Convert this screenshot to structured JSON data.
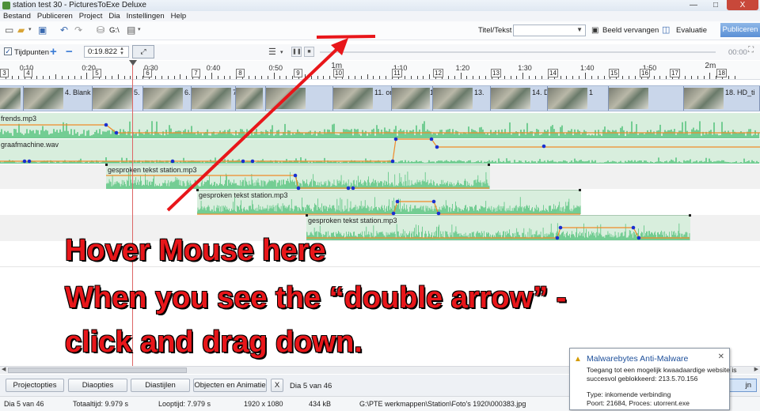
{
  "window": {
    "title": "station test 30 - PicturesToExe Deluxe",
    "minimize": "—",
    "maximize": "□",
    "close": "X"
  },
  "menu": [
    "Bestand",
    "Publiceren",
    "Project",
    "Dia",
    "Instellingen",
    "Help"
  ],
  "toolbar": {
    "path_label": "G:\\",
    "titel_label": "Titel/Tekst",
    "titel_value": "",
    "beeld_label": "Beeld vervangen",
    "evaluatie_label": "Evaluatie",
    "publiceren_label": "Publiceren"
  },
  "timebar": {
    "tijdpunten_label": "Tijdpunten",
    "tijdpunten_checked": true,
    "time_value": "0:19.822",
    "time_end": "00:00"
  },
  "ruler": {
    "labels": [
      "0:10",
      "0:20",
      "0:30",
      "0:40",
      "0:50",
      "1m",
      "1:10",
      "1:20",
      "1:30",
      "1:40",
      "1:50",
      "2m"
    ],
    "slide_markers": [
      "3",
      "4",
      "5",
      "6",
      "7",
      "8",
      "9",
      "10",
      "11",
      "12",
      "13",
      "14",
      "15",
      "16",
      "17",
      "18"
    ]
  },
  "slides": [
    {
      "label": ""
    },
    {
      "label": "4. Blank"
    },
    {
      "label": "5."
    },
    {
      "label": "6."
    },
    {
      "label": "7."
    },
    {
      "label": ""
    },
    {
      "label": ""
    },
    {
      "label": "11. on"
    },
    {
      "label": "12. DS"
    },
    {
      "label": "13."
    },
    {
      "label": "14. DS"
    },
    {
      "label": "1"
    },
    {
      "label": ""
    },
    {
      "label": "18. HD_ti"
    }
  ],
  "tracks": {
    "frends": "frends.mp3",
    "graafmachine": "graafmachine.wav",
    "gesproken1": "gesproken tekst station.mp3",
    "gesproken2": "gesproken tekst station.mp3",
    "gesproken3": "gesproken tekst station.mp3"
  },
  "annotation": {
    "line1": "Hover Mouse here",
    "line2": "When you see the “double arrow” -",
    "line3": "click and drag down."
  },
  "bottom": {
    "projectopties": "Projectopties",
    "diaopties": "Diaopties",
    "diastijlen": "Diastijlen",
    "objecten": "Objecten en Animatie",
    "close_x": "X",
    "status": "Dia 5 van 46",
    "right_btn": "jn"
  },
  "statusbar": {
    "dia": "Dia 5 van 46",
    "totaaltijd": "Totaaltijd: 9.979 s",
    "looptijd": "Looptijd: 7.979 s",
    "resolution": "1920 x 1080",
    "size": "434 kB",
    "path": "G:\\PTE werkmappen\\Station\\Foto's 1920\\000383.jpg"
  },
  "toast": {
    "title": "Malwarebytes Anti-Malware",
    "line1": "Toegang tot een mogelijk kwaadaardige website is",
    "line2": "succesvol geblokkeerd: 213.5.70.156",
    "line3": "Type: inkomende verbinding",
    "line4": "Poort: 21684, Proces: utorrent.exe"
  },
  "colors": {
    "accent": "#5a8fd6",
    "annotation": "#e8161a",
    "waveform": "#3dbb6b",
    "envelope": "#f08a2a",
    "node": "#1a2fd0"
  }
}
